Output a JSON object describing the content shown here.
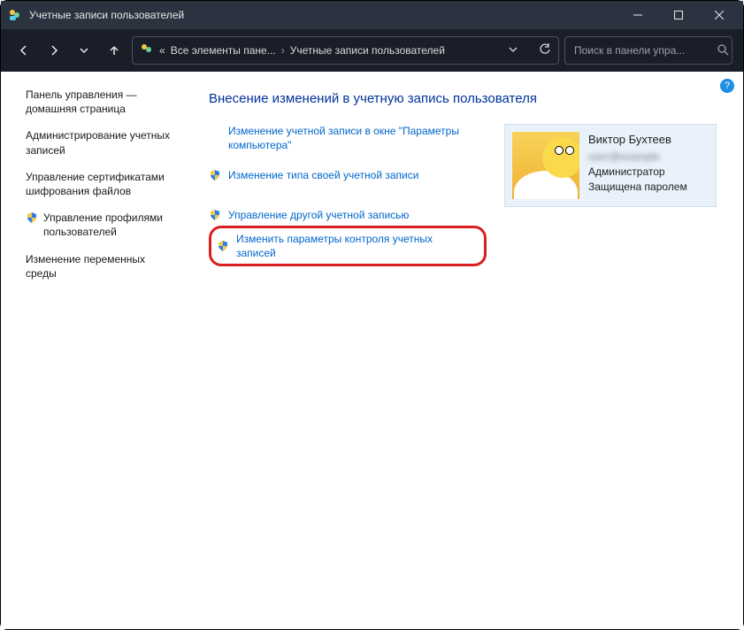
{
  "window": {
    "title": "Учетные записи пользователей"
  },
  "breadcrumb": {
    "overflow": "«",
    "crumb1": "Все элементы пане...",
    "crumb2": "Учетные записи пользователей"
  },
  "search": {
    "placeholder": "Поиск в панели упра..."
  },
  "sidebar": {
    "home": "Панель управления — домашняя страница",
    "items": [
      {
        "label": "Администрирование учетных записей",
        "shield": false
      },
      {
        "label": "Управление сертификатами шифрования файлов",
        "shield": false
      },
      {
        "label": "Управление профилями пользователей",
        "shield": true
      },
      {
        "label": "Изменение переменных среды",
        "shield": false
      }
    ]
  },
  "main": {
    "title": "Внесение изменений в учетную запись пользователя",
    "actions": [
      {
        "label": "Изменение учетной записи в окне \"Параметры компьютера\"",
        "shield": false
      },
      {
        "label": "Изменение типа своей учетной записи",
        "shield": true
      },
      {
        "label": "Управление другой учетной записью",
        "shield": true
      },
      {
        "label": "Изменить параметры контроля учетных записей",
        "shield": true,
        "highlighted": true
      }
    ]
  },
  "user": {
    "name": "Виктор Бухтеев",
    "email_masked": "user@example",
    "role": "Администратор",
    "protected": "Защищена паролем"
  },
  "help": "?"
}
